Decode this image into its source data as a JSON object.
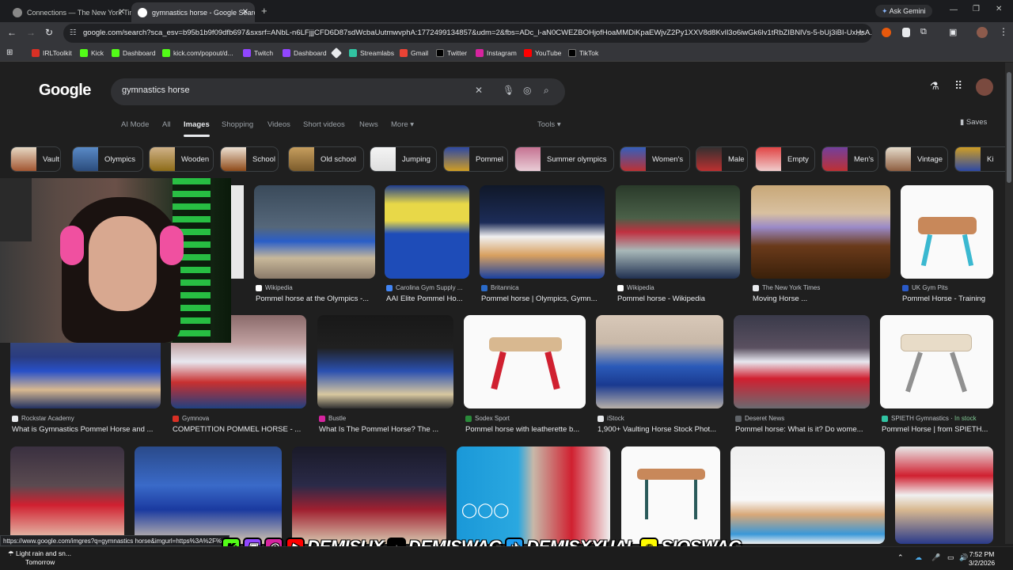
{
  "browser": {
    "tabs": [
      {
        "title": "Connections — The New York Times",
        "active": false
      },
      {
        "title": "gymnastics horse - Google Search",
        "active": true
      }
    ],
    "new_tab": "+",
    "gemini_label": "Ask Gemini",
    "url": "google.com/search?sca_esv=b95b1b9f09dfb697&sxsrf=ANbL-n6LFjjjCFD6D87sdWcbaUutmwvphA:1772499134857&udm=2&fbs=ADc_l-aN0CWEZBOHjofHoaMMDiKpaEWjvZ2Py1XXV8d8KvIl3o6iwGk6lv1tRbZIBNlVs-5-bUj3iBI-UxHsA...",
    "bookmarks": [
      "IRLToolkit",
      "Kick",
      "Dashboard",
      "kick.com/popout/d...",
      "Twitch",
      "Dashboard",
      "Streamlabs",
      "Gmail",
      "Twitter",
      "Instagram",
      "YouTube",
      "TikTok"
    ]
  },
  "search": {
    "logo": "Google",
    "query": "gymnastics horse",
    "tabs": [
      "AI Mode",
      "All",
      "Images",
      "Shopping",
      "Videos",
      "Short videos",
      "News",
      "More"
    ],
    "active_tab": "Images",
    "tools_label": "Tools",
    "saves_label": "Saves"
  },
  "chips": [
    "Vault",
    "Olympics",
    "Wooden",
    "School",
    "Old school",
    "Jumping",
    "Pommel",
    "Summer olympics",
    "Women's",
    "Male",
    "Empty",
    "Men's",
    "Vintage",
    "Ki"
  ],
  "results_row1": [
    {
      "source": "Wikipedia",
      "title": "Pommel horse at the Olympics -..."
    },
    {
      "source": "Carolina Gym Supply ...",
      "title": "AAI Elite Pommel Ho..."
    },
    {
      "source": "Britannica",
      "title": "Pommel horse | Olympics, Gymn..."
    },
    {
      "source": "Wikipedia",
      "title": "Pommel horse - Wikipedia"
    },
    {
      "source": "The New York Times",
      "title": "Moving Horse ..."
    },
    {
      "source": "UK Gym Pits",
      "title": "Pommel Horse - Training"
    }
  ],
  "results_row2": [
    {
      "source": "Rockstar Academy",
      "title": "What is Gymnastics Pommel Horse and ..."
    },
    {
      "source": "Gymnova",
      "title": "COMPETITION POMMEL HORSE - ..."
    },
    {
      "source": "Bustle",
      "title": "What Is The Pommel Horse? The ..."
    },
    {
      "source": "Sodex Sport",
      "title": "Pommel horse with leatherette b..."
    },
    {
      "source": "iStock",
      "title": "1,900+ Vaulting Horse Stock Phot..."
    },
    {
      "source": "Deseret News",
      "title": "Pommel horse: What is it? Do wome..."
    },
    {
      "source": "SPIETH Gymnastics",
      "badge": "In stock",
      "title": "Pommel Horse | from SPIETH..."
    }
  ],
  "row1_partial_caption": "c",
  "status_url": "https://www.google.com/imgres?q=gymnastics horse&imgurl=https%3A%2F%...",
  "overlay_handles": [
    "DEMISUX",
    "DEMISWAG",
    "DEMISXXUAL",
    "SIOSWAG"
  ],
  "taskbar": {
    "weather_line1": "Light rain and sn...",
    "weather_line2": "Tomorrow",
    "time": "7:52 PM",
    "date": "3/2/2026"
  },
  "colors": {
    "background": "#1f1f1f",
    "accent": "#8ab4f8",
    "in_stock": "#81c995"
  }
}
